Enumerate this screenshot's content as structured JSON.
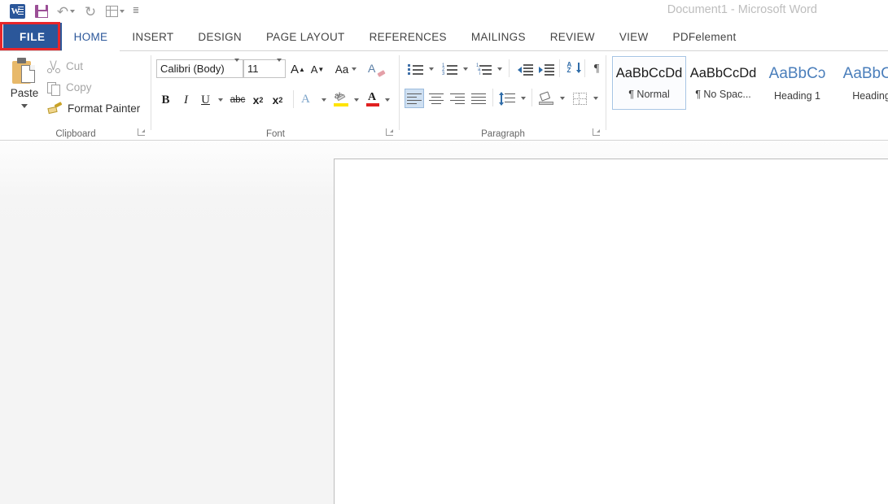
{
  "titlebar": {
    "app_title": "Document1 - Microsoft Word",
    "quick_access": [
      {
        "name": "word-logo-icon",
        "label": "W"
      },
      {
        "name": "save-icon",
        "label": "Save"
      },
      {
        "name": "undo-icon",
        "label": "Undo"
      },
      {
        "name": "redo-icon",
        "label": "Redo"
      },
      {
        "name": "table-icon",
        "label": "Draw Table"
      },
      {
        "name": "customize-qat-icon",
        "label": "Customize Quick Access Toolbar"
      }
    ]
  },
  "tabs": [
    {
      "label": "FILE",
      "state": "highlighted"
    },
    {
      "label": "HOME",
      "state": "active"
    },
    {
      "label": "INSERT",
      "state": "normal"
    },
    {
      "label": "DESIGN",
      "state": "normal"
    },
    {
      "label": "PAGE LAYOUT",
      "state": "normal"
    },
    {
      "label": "REFERENCES",
      "state": "normal"
    },
    {
      "label": "MAILINGS",
      "state": "normal"
    },
    {
      "label": "REVIEW",
      "state": "normal"
    },
    {
      "label": "VIEW",
      "state": "normal"
    },
    {
      "label": "PDFelement",
      "state": "normal"
    }
  ],
  "highlight": {
    "target": "FILE",
    "color": "#e8262a"
  },
  "ribbon": {
    "clipboard": {
      "group_label": "Clipboard",
      "paste_label": "Paste",
      "cut_label": "Cut",
      "copy_label": "Copy",
      "format_painter_label": "Format Painter"
    },
    "font": {
      "group_label": "Font",
      "font_name": "Calibri (Body)",
      "font_size": "11",
      "grow_font": "A",
      "shrink_font": "A",
      "change_case": "Aa",
      "clear_formatting": "A",
      "bold": "B",
      "italic": "I",
      "underline": "U",
      "strikethrough": "abc",
      "subscript": "x",
      "subscript_index": "2",
      "superscript": "x",
      "superscript_index": "2",
      "text_effects": "A",
      "highlight": "ab",
      "font_color": "A"
    },
    "paragraph": {
      "group_label": "Paragraph",
      "bullets": "Bullets",
      "numbering": "Numbering",
      "multilevel": "Multilevel List",
      "decrease_indent": "Decrease Indent",
      "increase_indent": "Increase Indent",
      "sort": "Sort",
      "show_marks": "¶",
      "align_left": "Align Left",
      "align_center": "Center",
      "align_right": "Align Right",
      "justify": "Justify",
      "line_spacing": "Line and Paragraph Spacing",
      "shading": "Shading",
      "borders": "Borders"
    },
    "styles": {
      "items": [
        {
          "preview": "AaBbCcDd",
          "name": "¶ Normal",
          "kind": "body",
          "selected": true
        },
        {
          "preview": "AaBbCcDd",
          "name": "¶ No Spac...",
          "kind": "body",
          "selected": false
        },
        {
          "preview": "AaBbCɔ",
          "name": "Heading 1",
          "kind": "heading",
          "selected": false
        },
        {
          "preview": "AaBbCɔ",
          "name": "Heading",
          "kind": "heading",
          "selected": false
        }
      ]
    }
  },
  "document": {
    "page_content": ""
  },
  "colors": {
    "file_tab_bg": "#2b579a",
    "accent_blue": "#2b579a",
    "highlight_red": "#e8262a",
    "canvas_gray": "#f4f4f4",
    "page_white": "#ffffff"
  }
}
